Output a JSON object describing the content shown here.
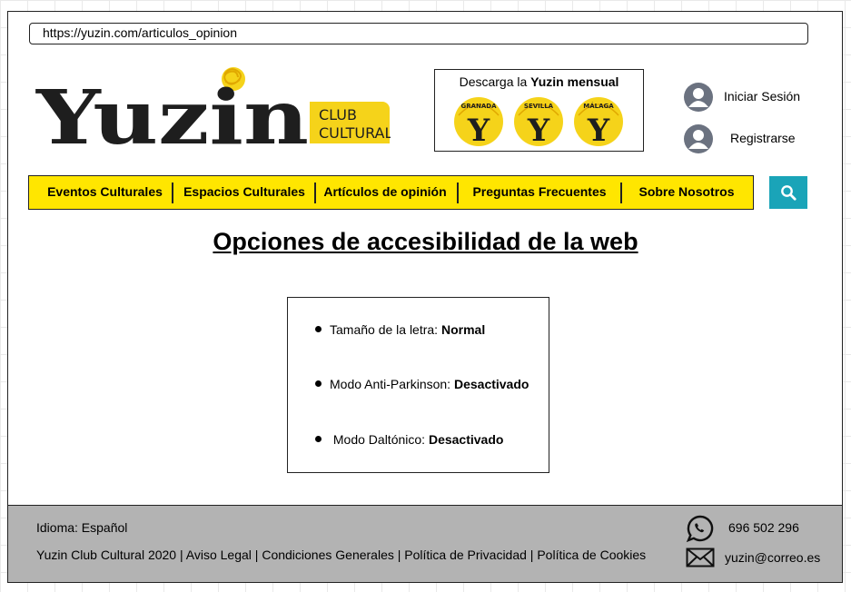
{
  "browser": {
    "url": "https://yuzin.com/articulos_opinion"
  },
  "header": {
    "logo": {
      "wordmark": "Yuzin",
      "tag_line1": "CLUB",
      "tag_line2": "CULTURAL"
    },
    "download": {
      "prefix": "Descarga la ",
      "highlight": "Yuzin mensual",
      "badges": [
        {
          "city": "GRANADA",
          "letter": "Y"
        },
        {
          "city": "SEVILLA",
          "letter": "Y"
        },
        {
          "city": "MÁLAGA",
          "letter": "Y"
        }
      ]
    },
    "account": {
      "login_label": "Iniciar Sesión",
      "register_label": "Registrarse"
    }
  },
  "nav": {
    "items": [
      {
        "label": "Eventos Culturales"
      },
      {
        "label": "Espacios Culturales"
      },
      {
        "label": "Artículos de opinión"
      },
      {
        "label": "Preguntas Frecuentes"
      },
      {
        "label": "Sobre Nosotros"
      }
    ],
    "search_icon": "search-icon"
  },
  "main": {
    "title": "Opciones de accesibilidad de la web",
    "options": [
      {
        "label": "Tamaño de la letra: ",
        "value": "Normal"
      },
      {
        "label": "Modo Anti-Parkinson: ",
        "value": "Desactivado"
      },
      {
        "label": " Modo Daltónico: ",
        "value": "Desactivado"
      }
    ]
  },
  "footer": {
    "language": "Idioma: Español",
    "copyright": "Yuzin Club Cultural 2020",
    "sep": " | ",
    "links": [
      "Aviso Legal",
      "Condiciones Generales",
      "Política de Privacidad",
      "Política de Cookies"
    ],
    "phone": "696 502 296",
    "email": "yuzin@correo.es"
  },
  "colors": {
    "accent_yellow": "#ffe600",
    "search_teal": "#1aa4b8",
    "footer_gray": "#b3b3b3",
    "logo_black": "#1e1e1e",
    "badge_yellow": "#f5d31a"
  }
}
